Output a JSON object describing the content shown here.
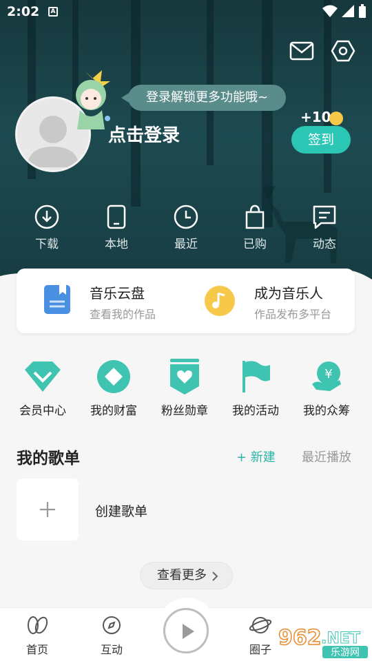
{
  "status_bar": {
    "time": "2:02",
    "notification_icon": "A"
  },
  "header": {
    "mail_icon": "mail-icon",
    "settings_icon": "settings-hexagon-icon",
    "bubble_text": "登录解锁更多功能哦~",
    "login_title": "点击登录",
    "bonus": "+10",
    "signin_label": "签到"
  },
  "quick_actions": [
    {
      "label": "下载",
      "icon": "download-icon"
    },
    {
      "label": "本地",
      "icon": "phone-icon"
    },
    {
      "label": "最近",
      "icon": "clock-icon"
    },
    {
      "label": "已购",
      "icon": "bag-icon"
    },
    {
      "label": "动态",
      "icon": "message-icon"
    }
  ],
  "card": {
    "left": {
      "title": "音乐云盘",
      "subtitle": "查看我的作品",
      "icon": "bookmark-book-icon"
    },
    "right": {
      "title": "成为音乐人",
      "subtitle": "作品发布多平台",
      "icon": "music-note-icon"
    }
  },
  "features": [
    {
      "label": "会员中心",
      "icon": "vip-diamond-icon"
    },
    {
      "label": "我的财富",
      "icon": "wealth-icon"
    },
    {
      "label": "粉丝勋章",
      "icon": "heart-badge-icon"
    },
    {
      "label": "我的活动",
      "icon": "flag-icon"
    },
    {
      "label": "我的众筹",
      "icon": "crowdfund-icon"
    }
  ],
  "playlists": {
    "title": "我的歌单",
    "new_label": "+ 新建",
    "recent_label": "最近播放",
    "create_label": "创建歌单",
    "more_label": "查看更多"
  },
  "tabbar": [
    {
      "label": "首页",
      "icon": "home-leaf-icon"
    },
    {
      "label": "互动",
      "icon": "compass-icon"
    },
    {
      "label": "圈子",
      "icon": "planet-icon"
    }
  ],
  "watermark": {
    "text": "962.NET",
    "sub": "乐游网"
  },
  "colors": {
    "accent": "#2bb5a5",
    "hero": "#1d4a50",
    "gold": "#f6c94a",
    "blue": "#4a90e2"
  }
}
